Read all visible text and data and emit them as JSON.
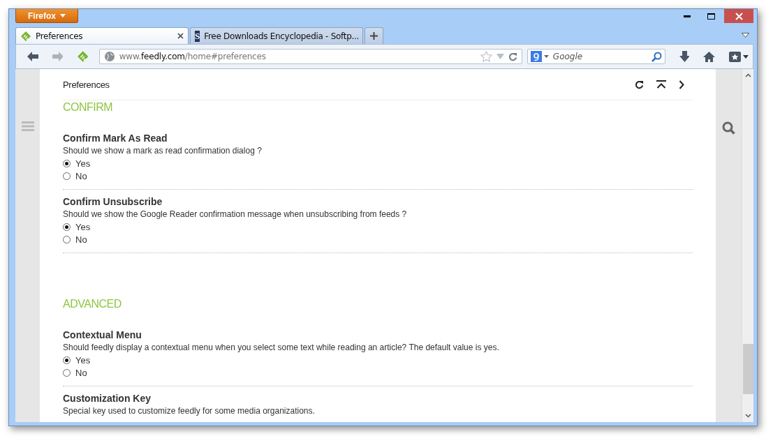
{
  "browser": {
    "menu_button": "Firefox",
    "tabs": [
      {
        "title": "Preferences",
        "selected": true,
        "kind": "leaf"
      },
      {
        "title": "Free Downloads Encyclopedia - Softp...",
        "selected": false,
        "kind": "letter",
        "letter": "S"
      }
    ],
    "url": {
      "prefix": "www.",
      "domain": "feedly.com",
      "path": "/home#preferences"
    },
    "search": {
      "placeholder": "Google"
    }
  },
  "page": {
    "header": "Preferences",
    "sections": [
      {
        "title": "CONFIRM",
        "settings": [
          {
            "title": "Confirm Mark As Read",
            "description": "Should we show a mark as read confirmation dialog ?",
            "options": [
              {
                "label": "Yes",
                "selected": true
              },
              {
                "label": "No",
                "selected": false
              }
            ]
          },
          {
            "title": "Confirm Unsubscribe",
            "description": "Should we show the Google Reader confirmation message when unsubscribing from feeds ?",
            "options": [
              {
                "label": "Yes",
                "selected": true
              },
              {
                "label": "No",
                "selected": false
              }
            ]
          }
        ]
      },
      {
        "title": "ADVANCED",
        "settings": [
          {
            "title": "Contextual Menu",
            "description": "Should feedly display a contextual menu when you select some text while reading an article? The default value is yes.",
            "options": [
              {
                "label": "Yes",
                "selected": true
              },
              {
                "label": "No",
                "selected": false
              }
            ]
          },
          {
            "title": "Customization Key",
            "description": "Special key used to customize feedly for some media organizations."
          }
        ]
      }
    ]
  }
}
